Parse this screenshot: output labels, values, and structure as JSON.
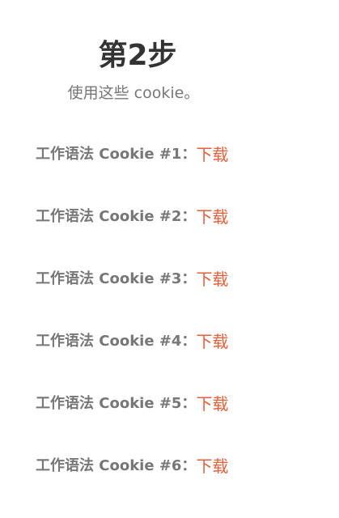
{
  "header": {
    "title": "第2步",
    "subtitle": "使用这些 cookie。"
  },
  "cookies": [
    {
      "label": "工作语法 Cookie #1：",
      "link": "下载"
    },
    {
      "label": "工作语法 Cookie #2：",
      "link": "下载"
    },
    {
      "label": "工作语法 Cookie #3：",
      "link": "下载"
    },
    {
      "label": "工作语法 Cookie #4：",
      "link": "下载"
    },
    {
      "label": "工作语法 Cookie #5：",
      "link": "下载"
    },
    {
      "label": "工作语法 Cookie #6：",
      "link": "下载"
    }
  ],
  "colors": {
    "title": "#333333",
    "text": "#777777",
    "link": "#e5603a",
    "background": "#ffffff"
  }
}
